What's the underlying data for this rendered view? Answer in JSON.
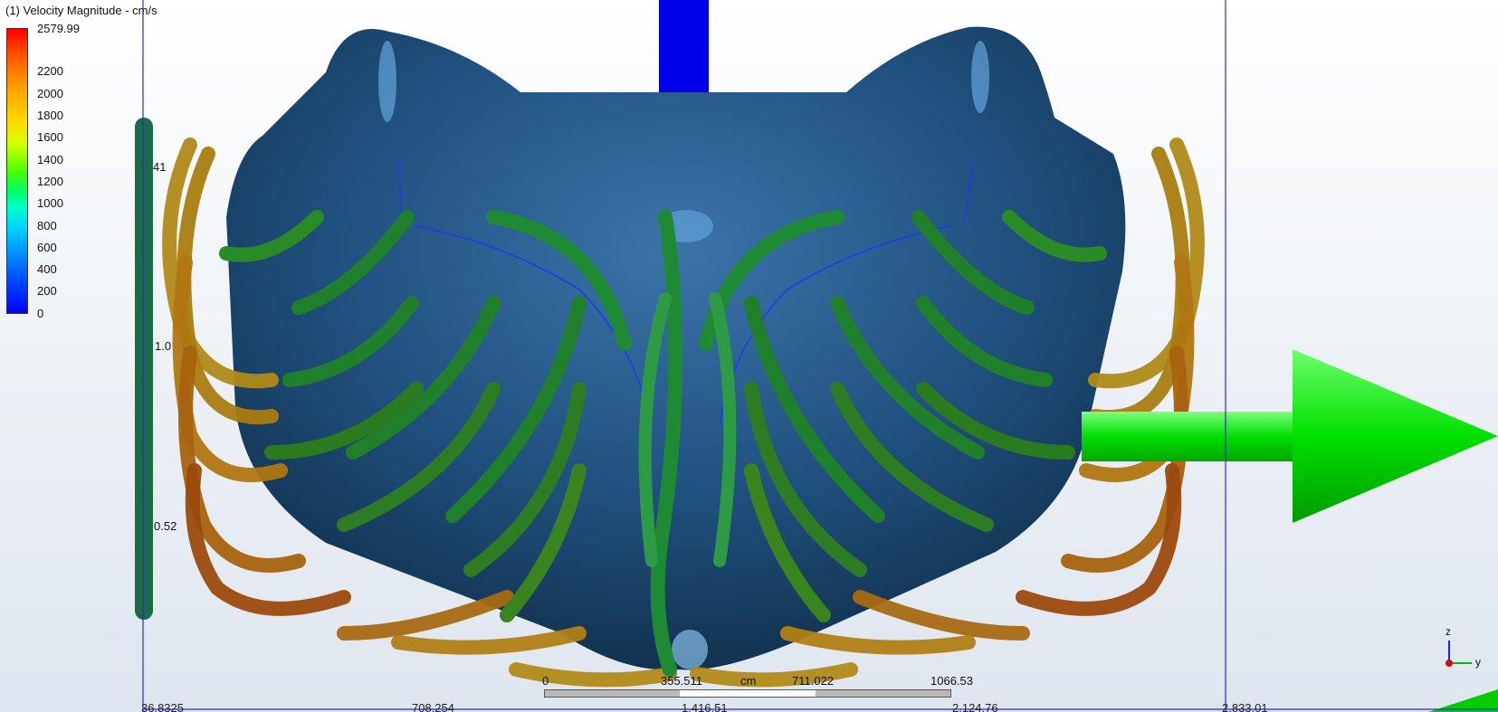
{
  "viewer": {
    "title": "(1) Velocity Magnitude - cm/s"
  },
  "legend": {
    "max_label": "2579.99",
    "ticks": [
      "2200",
      "2000",
      "1800",
      "1600",
      "1400",
      "1200",
      "1000",
      "800",
      "600",
      "400",
      "200",
      "0"
    ]
  },
  "scale": {
    "unit": "cm",
    "labels": [
      "0",
      "355.511",
      "711.022",
      "1066.53"
    ]
  },
  "ruler": {
    "labels": [
      "36.8325",
      "708.254",
      "1,416.51",
      "2,124.76",
      "2,833.01"
    ]
  },
  "side_labels": [
    "41",
    "1.0",
    "0.52"
  ],
  "triad": {
    "z_label": "z",
    "y_label": "y"
  },
  "colors": {
    "body": "#1d4a78",
    "streamline_green": "#1e8a2c",
    "streamline_orange": "#b8860b",
    "arrow_green": "#00dd00",
    "inlet_blue": "#0000ee"
  }
}
